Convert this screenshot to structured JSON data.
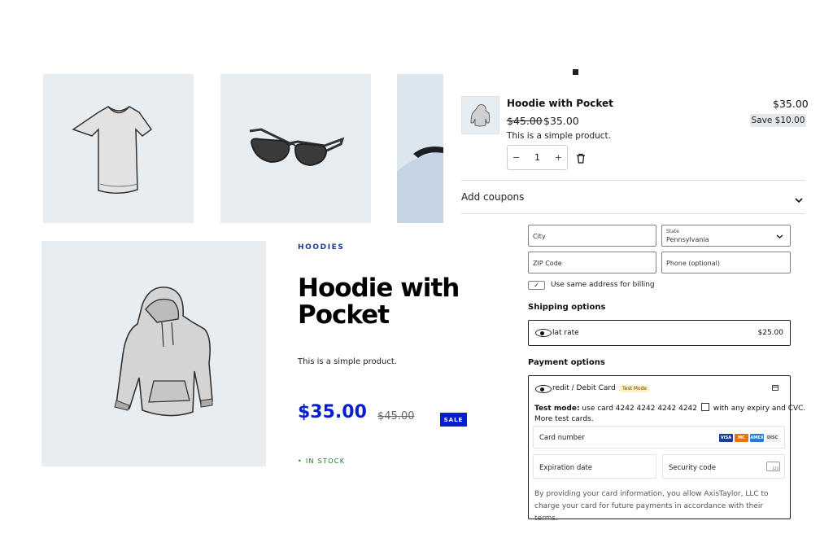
{
  "product": {
    "category": "HOODIES",
    "title": "Hoodie with Pocket",
    "description": "This is a simple product.",
    "price": "$35.00",
    "old_price": "$45.00",
    "sale_badge": "SALE",
    "stock": "• IN STOCK"
  },
  "cart_item": {
    "name": "Hoodie with Pocket",
    "total": "$35.00",
    "save": "Save $10.00",
    "old_price": "$45.00",
    "new_price": "$35.00",
    "description": "This is a simple product.",
    "quantity": "1",
    "decrease": "−",
    "increase": "+"
  },
  "coupons": {
    "label": "Add coupons"
  },
  "address": {
    "city_placeholder": "City",
    "state_label": "State",
    "state_value": "Pennsylvania",
    "zip_placeholder": "ZIP Code",
    "phone_placeholder": "Phone (optional)",
    "checkbox_mark": "✓",
    "same_billing_label": "Use same address for billing"
  },
  "shipping": {
    "title": "Shipping options",
    "option_label": "lat rate",
    "option_price": "$25.00"
  },
  "payment": {
    "title": "Payment options",
    "method_label": "redit / Debit Card",
    "test_badge": "Test Mode",
    "test_prefix": "Test mode:",
    "test_text": "use card 4242 4242 4242 4242",
    "test_suffix": "with any expiry and CVC.",
    "more_cards": "More test cards.",
    "card_number_label": "Card number",
    "expiration_label": "Expiration date",
    "security_label": "Security code",
    "security_icon_text": "123",
    "disclaimer": "By providing your card information, you allow AxisTaylor, LLC to charge your card for future payments in accordance with their terms.",
    "card_brands": [
      "VISA",
      "MC",
      "AMEX",
      "DISC"
    ]
  },
  "colors": {
    "accent": "#0a1fcc",
    "tile_bg": "#e8edf2",
    "in_stock": "#1a7a2a"
  }
}
